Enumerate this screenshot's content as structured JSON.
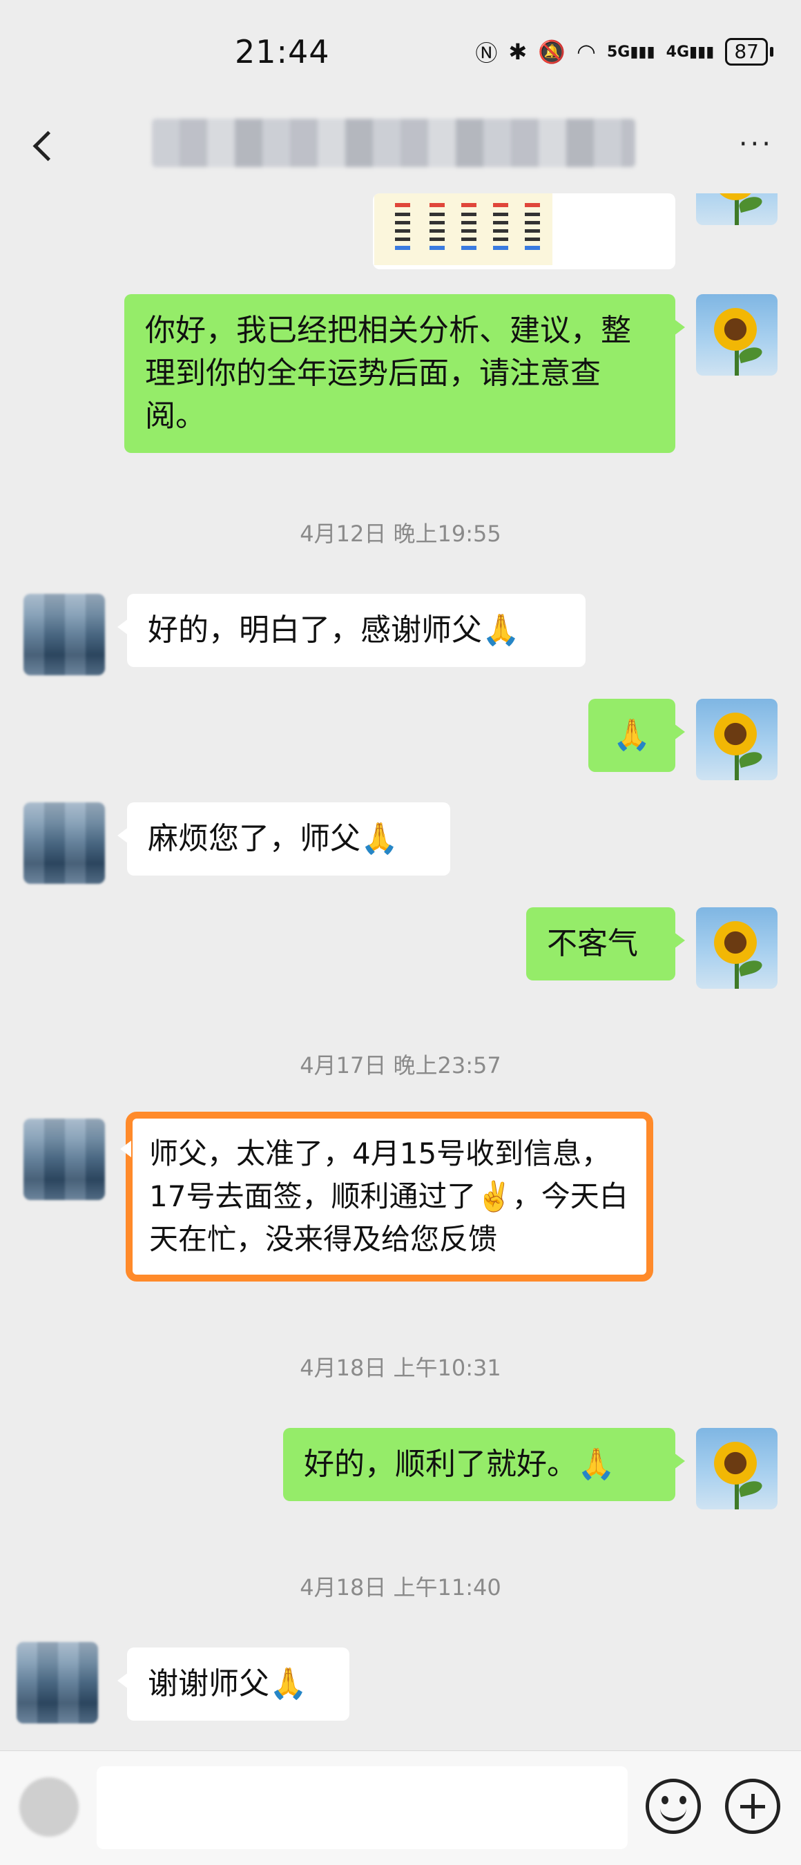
{
  "status_bar": {
    "time": "21:44",
    "icons": [
      "nfc-icon",
      "bluetooth-icon",
      "mute-icon",
      "wifi-icon",
      "signal-5g-icon",
      "signal-4g-icon"
    ],
    "net1": "5G",
    "net2": "4G",
    "battery": "87"
  },
  "header": {
    "back_icon": "back-arrow-icon",
    "title": "",
    "more_label": "···"
  },
  "messages": [
    {
      "type": "image",
      "side": "me",
      "description_icon": "image-thumbnail"
    },
    {
      "type": "text",
      "side": "me",
      "text": "你好，我已经把相关分析、建议，整理到你的全年运势后面，请注意查阅。"
    },
    {
      "type": "time",
      "text": "4月12日 晚上19:55"
    },
    {
      "type": "text",
      "side": "them",
      "text": "好的，明白了，感谢师父🙏"
    },
    {
      "type": "text",
      "side": "me",
      "text": "🙏"
    },
    {
      "type": "text",
      "side": "them",
      "text": "麻烦您了，师父🙏"
    },
    {
      "type": "text",
      "side": "me",
      "text": "不客气"
    },
    {
      "type": "time",
      "text": "4月17日 晚上23:57"
    },
    {
      "type": "text",
      "side": "them",
      "highlighted": true,
      "text": "师父，太准了，4月15号收到信息，17号去面签，顺利通过了✌️，今天白天在忙，没来得及给您反馈"
    },
    {
      "type": "time",
      "text": "4月18日 上午10:31"
    },
    {
      "type": "text",
      "side": "me",
      "text": "好的，顺利了就好。🙏"
    },
    {
      "type": "time",
      "text": "4月18日 上午11:40"
    },
    {
      "type": "text",
      "side": "them",
      "text": "谢谢师父🙏"
    }
  ],
  "input_bar": {
    "placeholder": "",
    "voice_icon": "voice-icon",
    "emoji_icon": "emoji-icon",
    "plus_icon": "plus-icon"
  },
  "colors": {
    "background": "#ededed",
    "my_bubble": "#95ec69",
    "their_bubble": "#ffffff",
    "highlight_border": "#ff8a2a",
    "timestamp": "#8a8a8a"
  }
}
